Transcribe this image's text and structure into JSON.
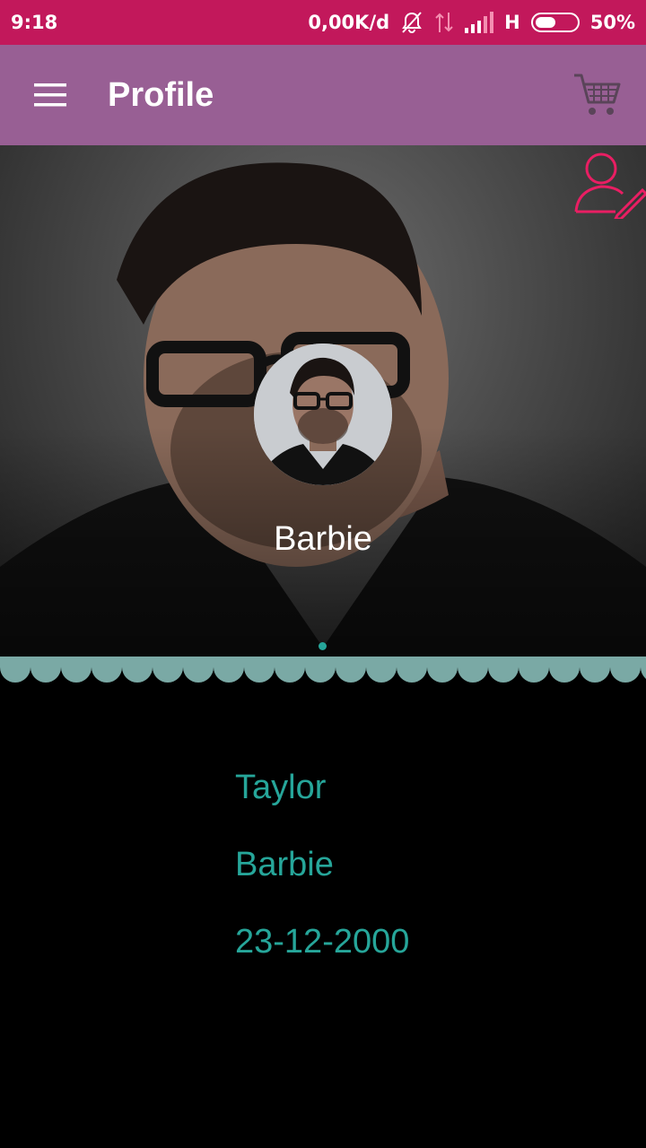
{
  "status_bar": {
    "time": "9:18",
    "network_speed": "0,00K/d",
    "network_type": "H",
    "battery": "50%",
    "battery_level": 0.5
  },
  "app_bar": {
    "title": "Profile",
    "menu_icon": "hamburger-menu-icon",
    "cart_icon": "cart-icon"
  },
  "profile": {
    "display_name": "Barbie",
    "edit_icon": "edit-profile-icon",
    "first_name": "Taylor",
    "last_name": "Barbie",
    "date_of_birth": "23-12-2000"
  },
  "colors": {
    "status_bar": "#c2185b",
    "app_bar": "#985f94",
    "accent": "#26a69a",
    "scallop": "#7aa9a5",
    "edit_icon": "#e91e63"
  }
}
